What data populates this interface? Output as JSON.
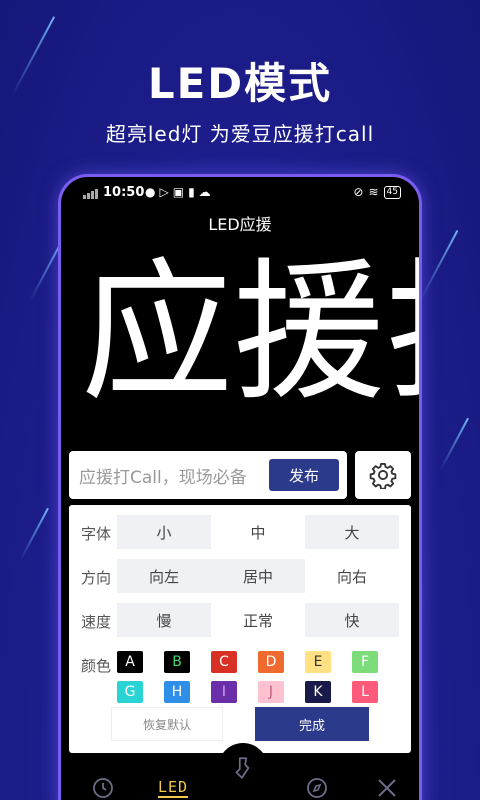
{
  "banner": {
    "headline": "LED模式",
    "subline": "超亮led灯 为爱豆应援打call"
  },
  "status_bar": {
    "time": "10:50",
    "battery": "45"
  },
  "app": {
    "title": "LED应援",
    "led_text": "应援打"
  },
  "input": {
    "placeholder": "应援打Call，现场必备",
    "publish_label": "发布"
  },
  "settings": {
    "font": {
      "label": "字体",
      "options": [
        "小",
        "中",
        "大"
      ]
    },
    "direction": {
      "label": "方向",
      "options": [
        "向左",
        "居中",
        "向右"
      ]
    },
    "speed": {
      "label": "速度",
      "options": [
        "慢",
        "正常",
        "快"
      ]
    },
    "color": {
      "label": "颜色",
      "swatches": [
        {
          "letter": "A",
          "bg": "#000000",
          "fg": "#ffffff"
        },
        {
          "letter": "B",
          "bg": "#000000",
          "fg": "#3fd46b"
        },
        {
          "letter": "C",
          "bg": "#d93025",
          "fg": "#ffffff"
        },
        {
          "letter": "D",
          "bg": "#f06a2f",
          "fg": "#ffffff"
        },
        {
          "letter": "E",
          "bg": "#ffe082",
          "fg": "#333333"
        },
        {
          "letter": "F",
          "bg": "#7ddc7a",
          "fg": "#ffffff"
        },
        {
          "letter": "G",
          "bg": "#2bd4d4",
          "fg": "#ffffff"
        },
        {
          "letter": "H",
          "bg": "#2f8fe8",
          "fg": "#ffffff"
        },
        {
          "letter": "I",
          "bg": "#6a2fa8",
          "fg": "#d0a0ff"
        },
        {
          "letter": "J",
          "bg": "#ffc0d0",
          "fg": "#c06080"
        },
        {
          "letter": "K",
          "bg": "#1a1a4a",
          "fg": "#ffffff"
        },
        {
          "letter": "L",
          "bg": "#ff5a7a",
          "fg": "#ffffff"
        }
      ]
    },
    "reset_label": "恢复默认",
    "done_label": "完成"
  },
  "nav": {
    "led_label": "LED"
  },
  "colors": {
    "accent": "#2c3a8c",
    "phone_border": "#7b5cf0",
    "nav_active": "#f2c94c"
  }
}
